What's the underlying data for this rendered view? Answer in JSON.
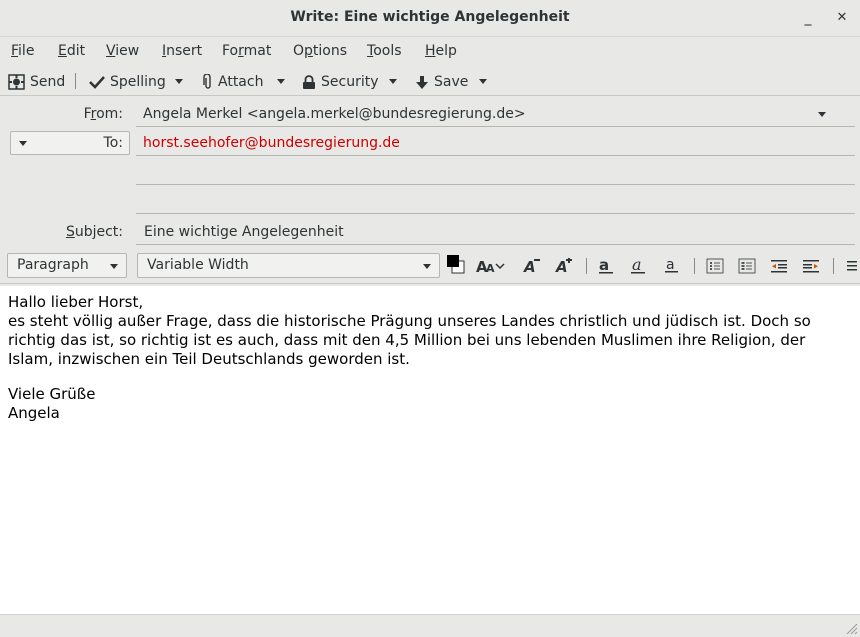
{
  "window": {
    "title": "Write: Eine wichtige Angelegenheit",
    "minimize_glyph": "_",
    "close_glyph": "✕"
  },
  "menu": [
    {
      "label": "File",
      "key": "F",
      "rest": "ile"
    },
    {
      "label": "Edit",
      "key": "E",
      "rest": "dit"
    },
    {
      "label": "View",
      "key": "V",
      "rest": "iew"
    },
    {
      "label": "Insert",
      "key": "I",
      "rest": "nsert"
    },
    {
      "label": "Format",
      "pre": "Fo",
      "key": "r",
      "rest": "mat"
    },
    {
      "label": "Options",
      "pre": "O",
      "key": "p",
      "rest": "tions"
    },
    {
      "label": "Tools",
      "key": "T",
      "rest": "ools"
    },
    {
      "label": "Help",
      "key": "H",
      "rest": "elp"
    }
  ],
  "toolbar": {
    "send": "Send",
    "spelling": "Spelling",
    "attach": "Attach",
    "security": "Security",
    "save": "Save"
  },
  "headers": {
    "from_label": "From:",
    "from_value": "Angela Merkel <angela.merkel@bundesregierung.de>",
    "to_label": "To:",
    "to_value": "horst.seehofer@bundesregierung.de",
    "subject_label": "Subject:",
    "subject_value": "Eine wichtige Angelegenheit"
  },
  "format": {
    "paragraph_style": "Paragraph",
    "font": "Variable Width"
  },
  "message": {
    "lines": [
      "Hallo lieber Horst,",
      "es steht völlig außer Frage, dass die historische Prägung unseres Landes christlich und jüdisch ist. Doch so richtig das ist, so richtig ist es auch, dass mit den 4,5 Million bei uns lebenden Muslimen ihre Religion, der Islam, inzwischen ein Teil Deutschlands geworden ist."
    ],
    "closing": "Viele Grüße",
    "signature": "Angela"
  },
  "colors": {
    "recipient_text": "#cc0000",
    "text_color_swatch": "#000000"
  },
  "icons": [
    "send-icon",
    "spelling-check-icon",
    "paperclip-icon",
    "lock-icon",
    "save-arrow-icon"
  ]
}
